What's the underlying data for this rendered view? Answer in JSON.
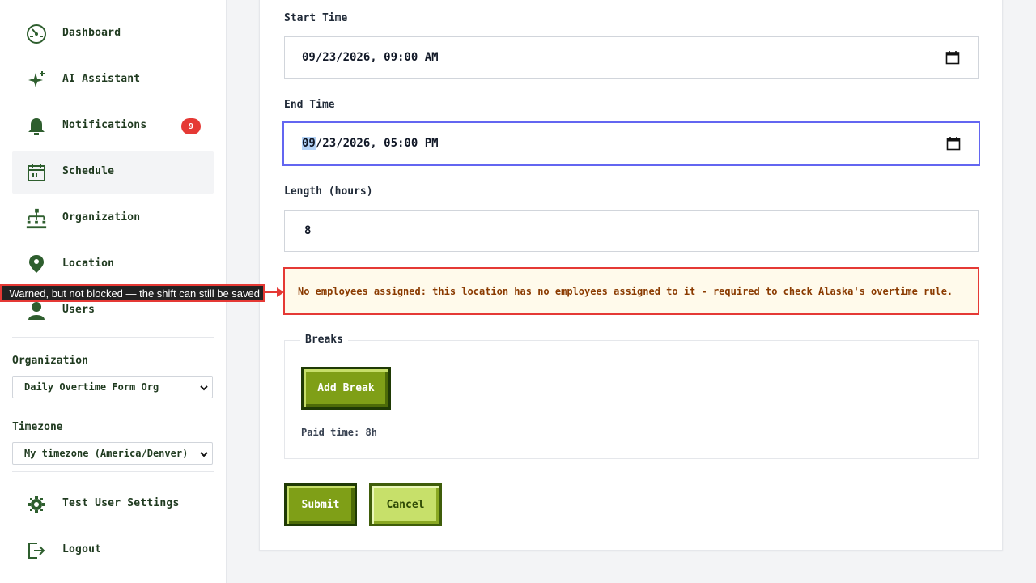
{
  "sidebar": {
    "items": [
      {
        "label": "Dashboard",
        "icon": "dashboard-icon"
      },
      {
        "label": "AI Assistant",
        "icon": "sparkle-icon"
      },
      {
        "label": "Notifications",
        "icon": "bell-icon",
        "badge": "9"
      },
      {
        "label": "Schedule",
        "icon": "calendar-icon",
        "active": true
      },
      {
        "label": "Organization",
        "icon": "org-chart-icon"
      },
      {
        "label": "Location",
        "icon": "map-pin-icon"
      },
      {
        "label": "Users",
        "icon": "user-icon"
      }
    ],
    "organization_label": "Organization",
    "organization_value": "Daily Overtime Form Org",
    "timezone_label": "Timezone",
    "timezone_value": "My timezone (America/Denver)",
    "settings_label": "Test User Settings",
    "logout_label": "Logout"
  },
  "form": {
    "start_label": "Start Time",
    "start_value": "09/23/2026, 09:00 AM",
    "end_label": "End Time",
    "end_value_selected": "09",
    "end_value_rest": "/23/2026, 05:00 PM",
    "length_label": "Length (hours)",
    "length_value": "8",
    "warning": "No employees assigned: this location has no employees assigned to it - required to check Alaska's overtime rule.",
    "breaks_legend": "Breaks",
    "add_break_label": "Add Break",
    "paid_time": "Paid time: 8h",
    "submit_label": "Submit",
    "cancel_label": "Cancel"
  },
  "annotation": "Warned, but not blocked — the shift can still be saved",
  "colors": {
    "brand_green": "#7f9f17",
    "focus": "#6366f1",
    "warning_border": "#e53935",
    "badge": "#e53935"
  }
}
